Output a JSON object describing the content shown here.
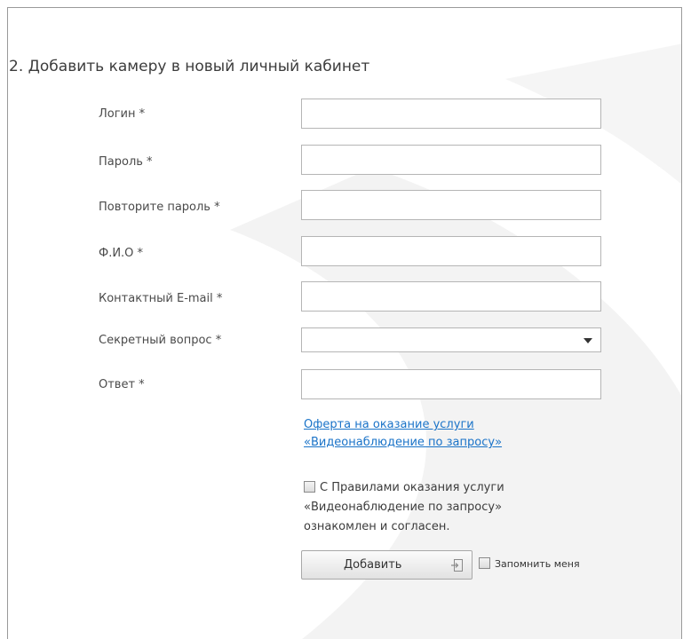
{
  "section_title": "2. Добавить камеру в новый личный кабинет",
  "fields": [
    {
      "label": "Логин *",
      "value": ""
    },
    {
      "label": "Пароль *",
      "value": ""
    },
    {
      "label": "Повторите пароль *",
      "value": ""
    },
    {
      "label": "Ф.И.О *",
      "value": ""
    },
    {
      "label": "Контактный E-mail *",
      "value": ""
    },
    {
      "label": "Секретный вопрос *",
      "value": ""
    },
    {
      "label": "Ответ *",
      "value": ""
    }
  ],
  "offer_link": {
    "line1": "Оферта на оказание услуги",
    "line2": "«Видеонаблюдение по запросу»"
  },
  "agreement": {
    "line1": "С Правилами оказания услуги",
    "line2": "«Видеонаблюдение по запросу»",
    "line3": "ознакомлен и согласен."
  },
  "add_button_label": "Добавить",
  "remember_label": "Запомнить меня",
  "colors": {
    "link": "#1a73c8",
    "border": "#b5b5b5",
    "watermark": "#f2f2f2"
  }
}
